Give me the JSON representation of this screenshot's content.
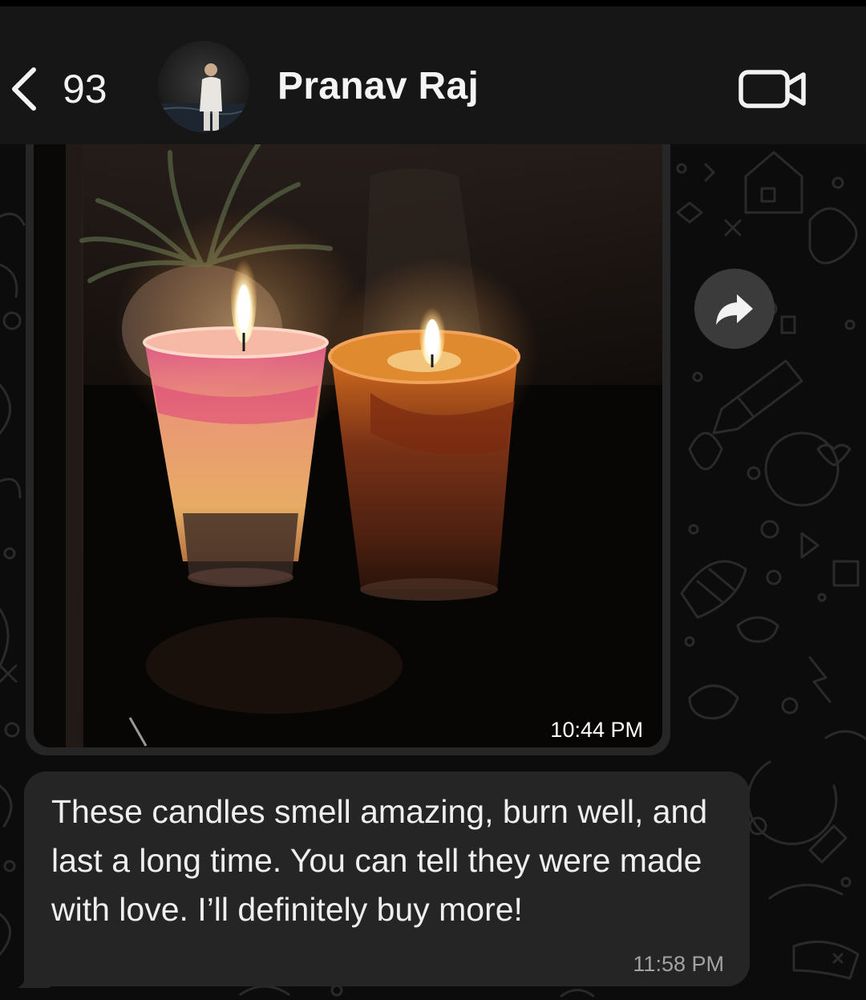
{
  "header": {
    "back_count": "93",
    "contact_name": "Pranav Raj",
    "icons": [
      "chevron-left-icon",
      "video-call-icon"
    ]
  },
  "messages": [
    {
      "type": "image",
      "content": "photo of two lit candles in glass jars",
      "time": "10:44 PM"
    },
    {
      "type": "text",
      "text": "These candles smell amazing, burn well, and last a long time. You can tell they were made with love. I’ll definitely buy more!",
      "time": "11:58 PM"
    }
  ],
  "actions": {
    "forward_icon": "forward-arrow-icon"
  },
  "colors": {
    "header_bg": "#161616",
    "bubble_bg": "#252525",
    "forward_btn_bg": "#3b3b3b",
    "text": "#efefef",
    "timestamp": "#a3a3a3"
  }
}
